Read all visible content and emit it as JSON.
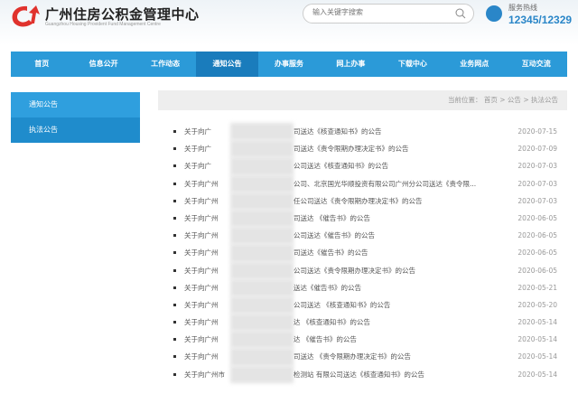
{
  "header": {
    "title": "广州住房公积金管理中心",
    "subtitle": "Guangzhou Housing Provident Fund Management Centre",
    "search_placeholder": "输入关键字搜索",
    "hotline_label": "服务热线",
    "hotline_number": "12345/12329"
  },
  "nav": [
    "首页",
    "信息公开",
    "工作动态",
    "通知公告",
    "办事服务",
    "网上办事",
    "下载中心",
    "业务网点",
    "互动交流"
  ],
  "sidebar": [
    "通知公告",
    "执法公告"
  ],
  "breadcrumb": "当前位置： 首页 > 公告 > 执法公告",
  "notices": [
    {
      "pre": "关于向广",
      "suf": "司送达《核查通知书》的公告",
      "date": "2020-07-15"
    },
    {
      "pre": "关于向广",
      "suf": "司送达《责令限期办理决定书》的公告",
      "date": "2020-07-09"
    },
    {
      "pre": "关于向广",
      "suf": "公司送达《核查通知书》的公告",
      "date": "2020-07-03"
    },
    {
      "pre": "关于向广州",
      "suf": "公司、北京国光华顺投资有限公司广州分公司送达《责令限...",
      "date": "2020-07-03"
    },
    {
      "pre": "关于向广州",
      "suf": "任公司送达《责令限期办理决定书》的公告",
      "date": "2020-07-03"
    },
    {
      "pre": "关于向广州",
      "suf": "司送达 《催告书》的公告",
      "date": "2020-06-05"
    },
    {
      "pre": "关于向广州",
      "suf": "公司送达《催告书》的公告",
      "date": "2020-06-05"
    },
    {
      "pre": "关于向广州",
      "suf": "司送达《催告书》的公告",
      "date": "2020-06-05"
    },
    {
      "pre": "关于向广州",
      "suf": "公司送达《责令限期办理决定书》的公告",
      "date": "2020-06-05"
    },
    {
      "pre": "关于向广州",
      "suf": "送达《催告书》的公告",
      "date": "2020-05-21"
    },
    {
      "pre": "关于向广州",
      "suf": "公司送达 《核查通知书》的公告",
      "date": "2020-05-20"
    },
    {
      "pre": "关于向广州",
      "suf": "达 《核查通知书》的公告",
      "date": "2020-05-14"
    },
    {
      "pre": "关于向广州",
      "suf": "达 《催告书》的公告",
      "date": "2020-05-14"
    },
    {
      "pre": "关于向广州",
      "suf": "司送达 《责令限期办理决定书》的公告",
      "date": "2020-05-14"
    },
    {
      "pre": "关于向广州市",
      "suf": "检测站 有限公司送达《核查通知书》的公告",
      "date": "2020-05-14"
    }
  ],
  "colors": {
    "nav": "#2b9ad8",
    "nav_active": "#1a7cbc",
    "logo": "#e0322d",
    "accent": "#2a86c8"
  }
}
